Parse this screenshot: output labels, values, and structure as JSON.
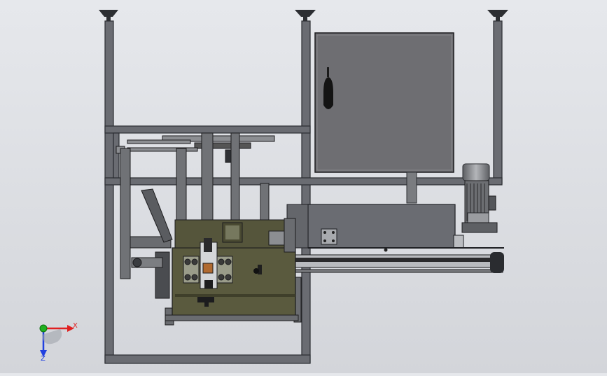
{
  "viewport": {
    "background": "#dcdee2",
    "frame_color": "#6a6c72",
    "frame_edge": "#2c2e32",
    "cabinet_color": "#6e6e72",
    "base_plate_color": "#5a5a3e",
    "motor_color": "#8a8c90"
  },
  "triad": {
    "x_label": "X",
    "z_label": "Z",
    "x_color": "#e02020",
    "y_color": "#20b020",
    "z_color": "#2040e0"
  }
}
